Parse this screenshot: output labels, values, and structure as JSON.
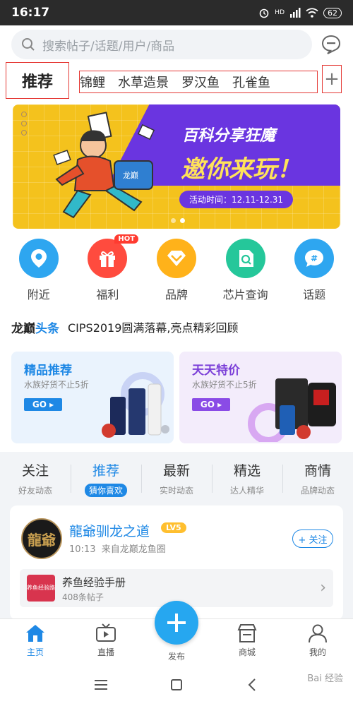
{
  "status_bar": {
    "time": "16:17",
    "battery": "62",
    "signal_label": "HD"
  },
  "search": {
    "placeholder": "搜索帖子/话题/用户/商品"
  },
  "categories": {
    "current": "推荐",
    "items": [
      "锦鲤",
      "水草造景",
      "罗汉鱼",
      "孔雀鱼"
    ],
    "add_label": "+"
  },
  "banner": {
    "title": "百科分享狂魔",
    "headline": "邀你来玩！",
    "time_range": "活动时间：12.11-12.31",
    "bag_label": "龙巅"
  },
  "quick_links": [
    {
      "label": "附近",
      "icon": "location-pin-icon",
      "color": "#2ea6f0"
    },
    {
      "label": "福利",
      "icon": "gift-icon",
      "color": "#ff4b3e",
      "badge": "HOT"
    },
    {
      "label": "品牌",
      "icon": "diamond-icon",
      "color": "#ffb21a"
    },
    {
      "label": "芯片查询",
      "icon": "chip-search-icon",
      "color": "#25c79a"
    },
    {
      "label": "话题",
      "icon": "hashtag-icon",
      "color": "#2ea6f0"
    }
  ],
  "headline": {
    "brand_prefix": "龙巅",
    "brand_suffix": "头条",
    "text": "CIPS2019圆满落幕,亮点精彩回顾"
  },
  "promos": [
    {
      "title": "精品推荐",
      "subtitle": "水族好货不止5折",
      "cta": "GO"
    },
    {
      "title": "天天特价",
      "subtitle": "水族好货不止5折",
      "cta": "GO"
    }
  ],
  "feed_tabs": [
    {
      "label": "关注",
      "sub": "好友动态",
      "active": false
    },
    {
      "label": "推荐",
      "sub": "猜你喜欢",
      "active": true
    },
    {
      "label": "最新",
      "sub": "实时动态",
      "active": false
    },
    {
      "label": "精选",
      "sub": "达人精华",
      "active": false
    },
    {
      "label": "商情",
      "sub": "品牌动态",
      "active": false
    }
  ],
  "post": {
    "author": "龍爺驯龙之道",
    "level": "LV5",
    "time": "10:13",
    "source": "来自龙巅龙鱼圈",
    "follow_label": "+ 关注",
    "avatar_text": "龍爺",
    "topic": {
      "title": "养鱼经验手册",
      "count": "408条帖子",
      "thumb_text": "养鱼经验路"
    }
  },
  "bottom_nav": [
    {
      "label": "主页",
      "icon": "home-icon",
      "active": true
    },
    {
      "label": "直播",
      "icon": "tv-icon",
      "active": false
    },
    {
      "label": "发布",
      "icon": "plus-icon",
      "active": false
    },
    {
      "label": "商城",
      "icon": "store-icon",
      "active": false
    },
    {
      "label": "我的",
      "icon": "user-icon",
      "active": false
    }
  ],
  "colors": {
    "accent": "#1e88e5",
    "promo_purple": "#7b3fd8",
    "highlight_box": "#e53935"
  },
  "watermark": "Bai 经验"
}
